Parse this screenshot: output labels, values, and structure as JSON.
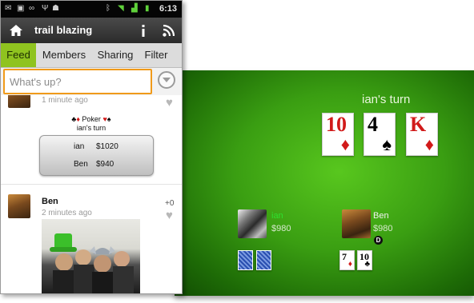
{
  "status_bar": {
    "time": "6:13",
    "left_icons": [
      "mail-icon",
      "calendar-icon",
      "voicemail-icon",
      "usb-icon",
      "android-icon"
    ],
    "right_icons": [
      "bluetooth-icon",
      "wifi-icon",
      "signal-icon",
      "battery-icon"
    ]
  },
  "app_bar": {
    "title": "trail blazing",
    "icons": [
      "home-icon",
      "info-icon",
      "rss-icon"
    ]
  },
  "tabs": [
    {
      "label": "Feed",
      "active": true
    },
    {
      "label": "Members",
      "active": false
    },
    {
      "label": "Sharing",
      "active": false
    },
    {
      "label": "Filter",
      "active": false
    }
  ],
  "compose": {
    "placeholder": "What's up?"
  },
  "feed": {
    "item1": {
      "time": "1 minute ago",
      "poker_title": "Poker",
      "poker_subtitle": "ian's turn",
      "scores": [
        {
          "name": "ian",
          "value": "$1020"
        },
        {
          "name": "Ben",
          "value": "$940"
        }
      ]
    },
    "item2": {
      "author": "Ben",
      "time": "2 minutes ago",
      "likes": "+0"
    }
  },
  "table": {
    "turn_text": "ian's turn",
    "community_cards": [
      {
        "rank": "10",
        "suit": "♦",
        "color": "#d11a1a"
      },
      {
        "rank": "4",
        "suit": "♠",
        "color": "#000000"
      },
      {
        "rank": "K",
        "suit": "♦",
        "color": "#d11a1a"
      }
    ],
    "players": [
      {
        "name": "ian",
        "money": "$980",
        "name_color": "#2fe02f"
      },
      {
        "name": "Ben",
        "money": "$980",
        "name_color": "#f2f2f2",
        "dealer": "D"
      }
    ],
    "ben_cards": [
      {
        "rank": "7",
        "suit": "♦",
        "color": "#d11a1a"
      },
      {
        "rank": "10",
        "suit": "♣",
        "color": "#000000"
      }
    ]
  },
  "colors": {
    "accent_tab": "#8fc31f",
    "input_border": "#f09a1a",
    "felt": "#3a9e12"
  }
}
